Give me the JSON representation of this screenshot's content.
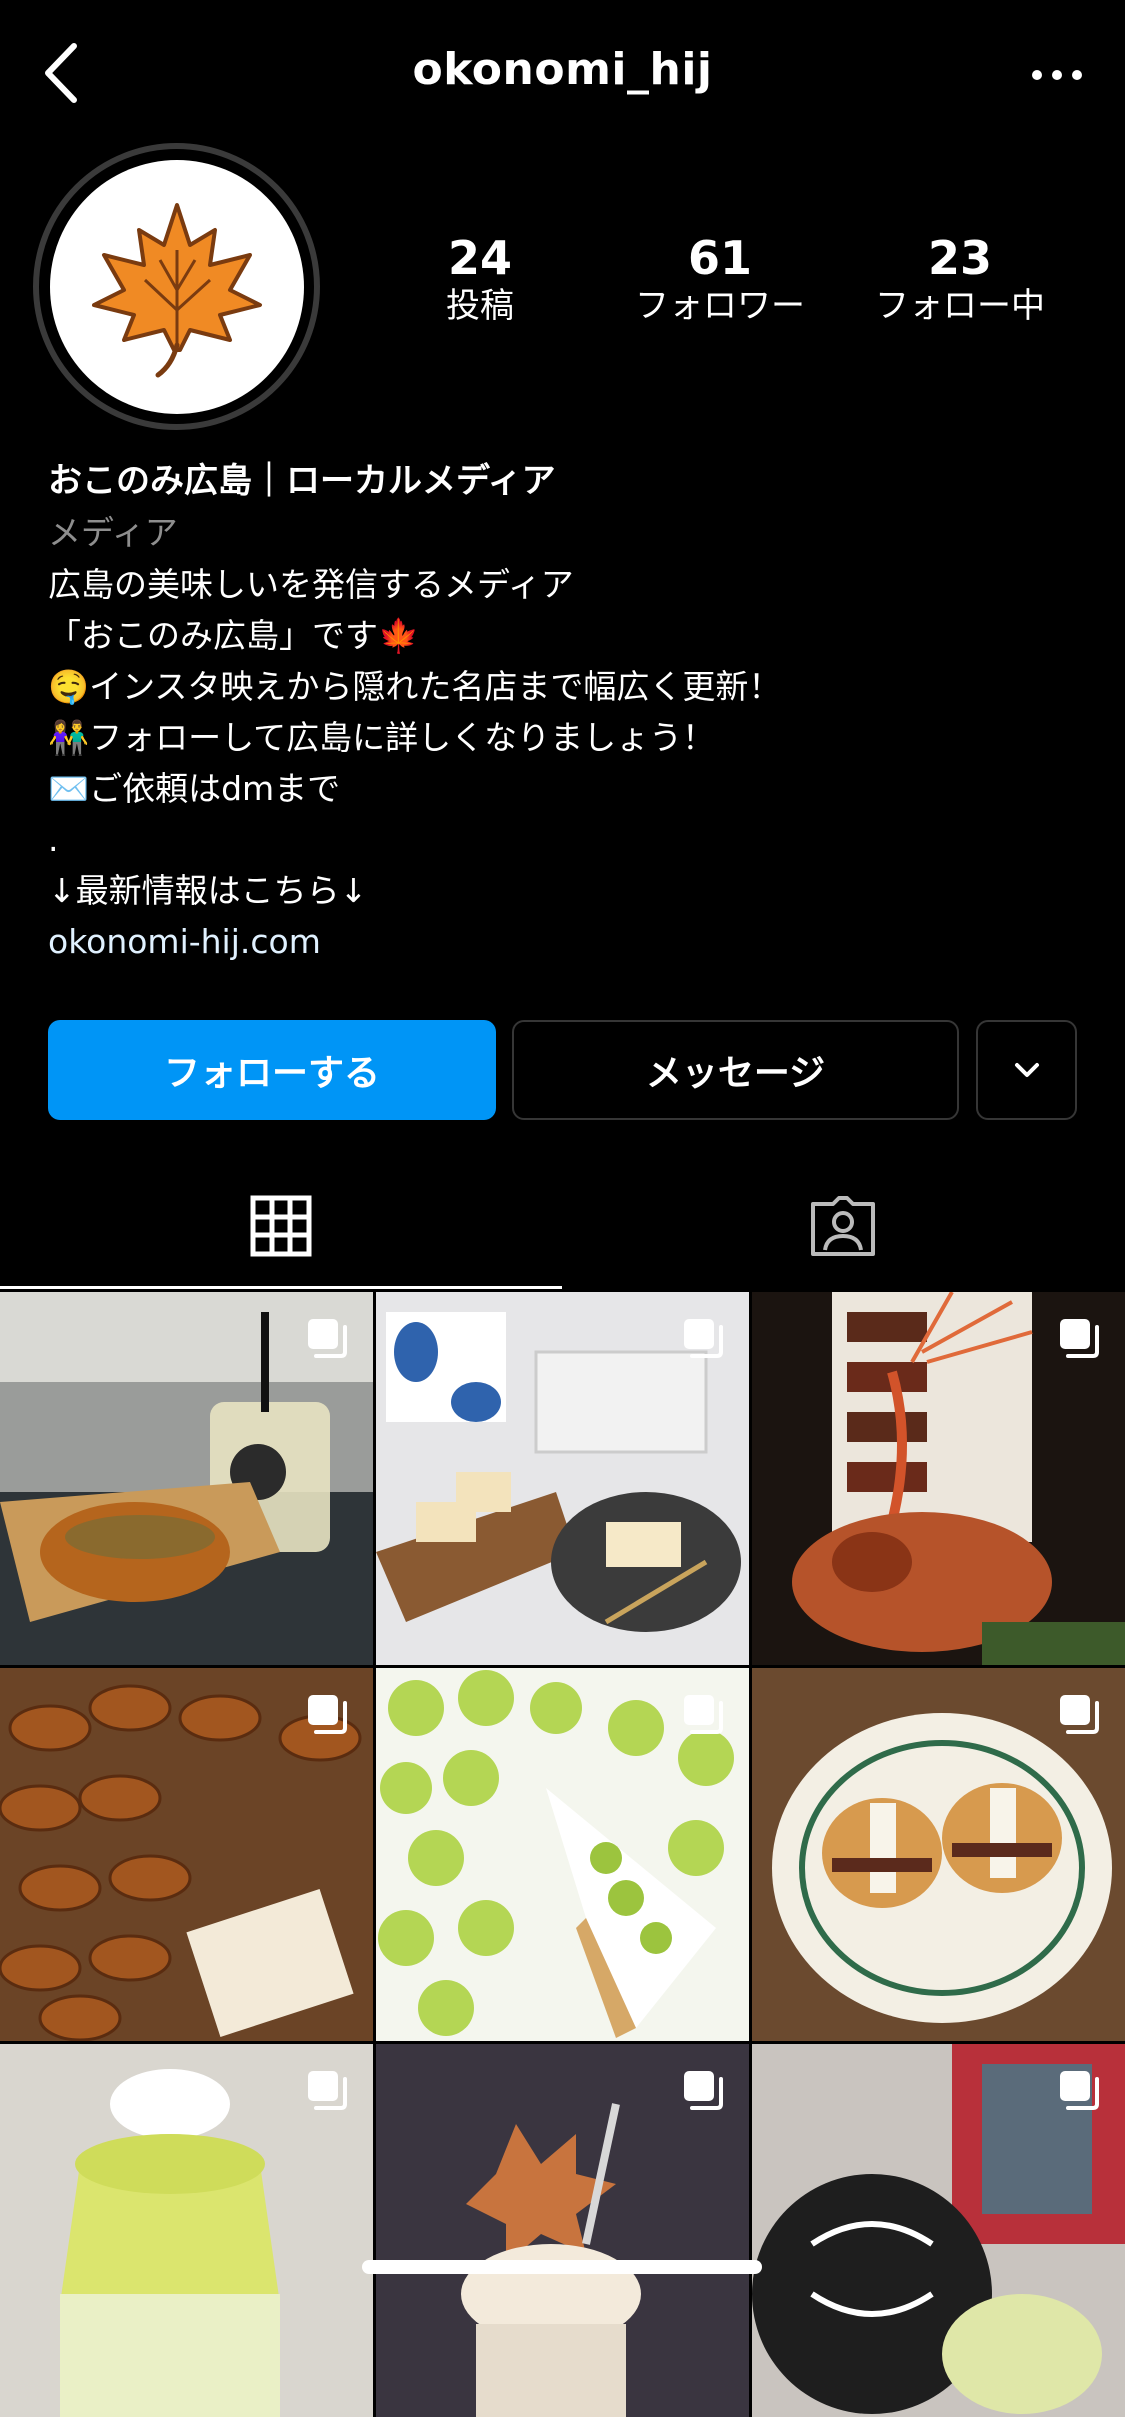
{
  "header": {
    "username": "okonomi_hij"
  },
  "profile": {
    "stats": [
      {
        "value": "24",
        "label": "投稿"
      },
      {
        "value": "61",
        "label": "フォロワー"
      },
      {
        "value": "23",
        "label": "フォロー中"
      }
    ],
    "name": "おこのみ広島｜ローカルメディア",
    "category": "メディア",
    "bio_lines": [
      "広島の美味しいを発信するメディア",
      "「おこのみ広島」です🍁",
      "🤤インスタ映えから隠れた名店まで幅広く更新！",
      "👫フォローして広島に詳しくなりましょう！",
      "✉️ご依頼はdmまで",
      ".",
      "↓最新情報はこちら↓"
    ],
    "link": "okonomi-hij.com"
  },
  "actions": {
    "follow_label": "フォローする",
    "message_label": "メッセージ"
  },
  "tabs": [
    {
      "icon": "grid-icon",
      "active": true
    },
    {
      "icon": "tagged-person-icon",
      "active": false
    }
  ],
  "posts": [
    {
      "subject": "hot dog and iced drink",
      "icon": "multiple-photos-icon"
    },
    {
      "subject": "cheesecake slices",
      "icon": "multiple-photos-icon"
    },
    {
      "subject": "fried shrimp",
      "icon": "multiple-photos-icon"
    },
    {
      "subject": "croissants",
      "icon": "multiple-photos-icon"
    },
    {
      "subject": "muscat grape cake",
      "icon": "multiple-photos-icon"
    },
    {
      "subject": "anpan sandwiches",
      "icon": "multiple-photos-icon"
    },
    {
      "subject": "melon shaved ice",
      "icon": "multiple-photos-icon"
    },
    {
      "subject": "maple manju dessert",
      "icon": "multiple-photos-icon"
    },
    {
      "subject": "Smiling Space drink",
      "icon": "multiple-photos-icon"
    }
  ],
  "colors": {
    "background": "#000000",
    "follow_button": "#0095f6",
    "border": "#363636",
    "muted_text": "#8e8e8e"
  }
}
